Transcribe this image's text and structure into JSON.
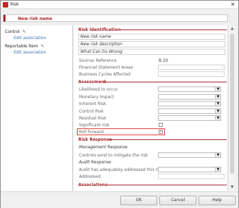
{
  "window": {
    "title": "Risk"
  },
  "name_bar": {
    "value": "New risk name"
  },
  "left_pane": {
    "sections": [
      {
        "heading": "Control",
        "link": "Edit association"
      },
      {
        "heading": "Reportable Item",
        "link": "Edit association"
      }
    ]
  },
  "risk_identification": {
    "heading": "Risk Identification",
    "name": "New risk name",
    "description": "New risk description",
    "what_can_go_wrong": "What Can Go Wrong",
    "source_reference_label": "Source/ Reference",
    "source_reference_value": "B.10",
    "financial_statement_areas_label": "Financial Statement Areas",
    "business_cycles_label": "Business Cycles Affected"
  },
  "assessment": {
    "heading": "Assessment",
    "fields": [
      {
        "label": "Likelihood to occur"
      },
      {
        "label": "Monetary Impact"
      },
      {
        "label": "Inherent Risk"
      },
      {
        "label": "Control Risk"
      },
      {
        "label": "Residual Risk"
      }
    ],
    "significant_risk_label": "Significant risk",
    "significant_risk_checked": false,
    "roll_forward_label": "Roll forward",
    "roll_forward_checked": true
  },
  "risk_response": {
    "heading": "Risk Response",
    "management_response": "Management Response",
    "controls_exist_label": "Controls exist to mitigate the risk",
    "audit_response": "Audit Response",
    "audit_addressed_label": "Audit has adequately addressed this risk",
    "addressed_label": "Addressed"
  },
  "associations": {
    "heading": "Associations"
  },
  "footer": {
    "ok": "OK",
    "cancel": "Cancel",
    "help": "Help"
  },
  "colors": {
    "accent": "#a31f24",
    "link": "#3a6fb0",
    "highlight": "#e53935"
  }
}
